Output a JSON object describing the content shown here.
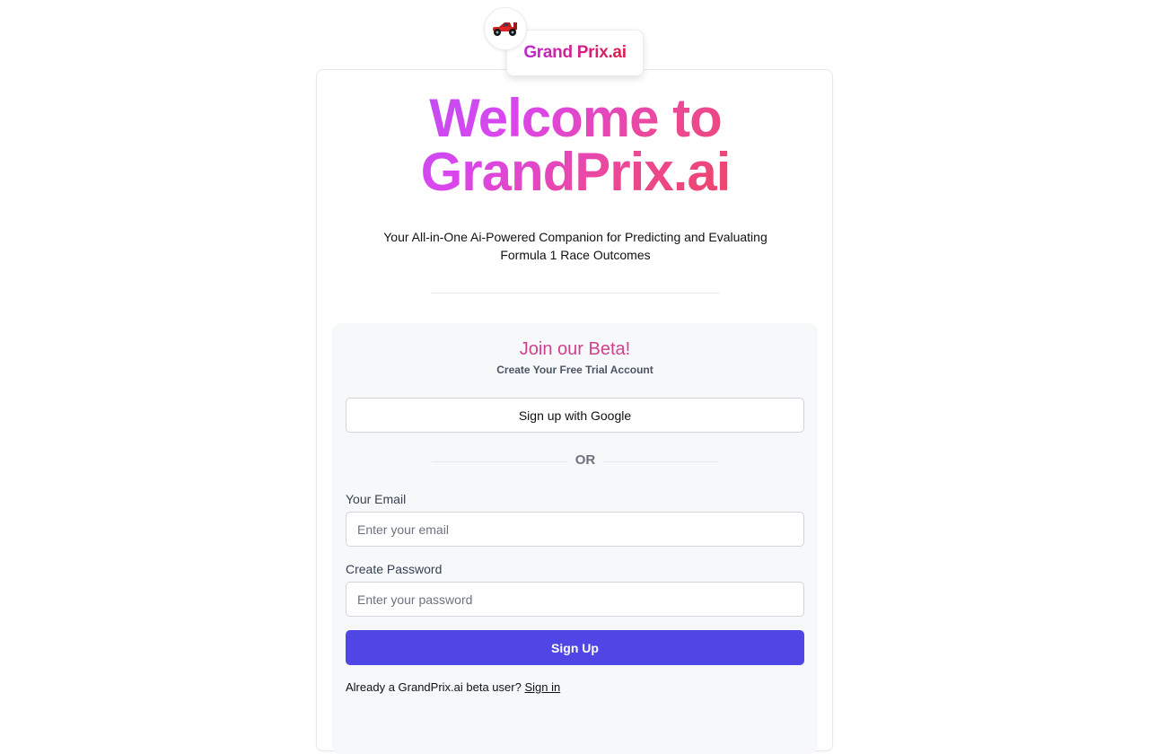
{
  "brand": {
    "logo_icon": "race-car-icon",
    "logo_text": "Grand Prix.ai"
  },
  "hero": {
    "title_line1": "Welcome to",
    "title_line2": "GrandPrix.ai",
    "subtitle_line1": "Your All-in-One Ai-Powered Companion for Predicting and Evaluating",
    "subtitle_line2": "Formula 1 Race Outcomes"
  },
  "signup": {
    "title": "Join our Beta!",
    "subtitle": "Create Your Free Trial Account",
    "google_button": "Sign up with Google",
    "or_text": "OR",
    "email_label": "Your Email",
    "email_placeholder": "Enter your email",
    "email_value": "",
    "password_label": "Create Password",
    "password_placeholder": "Enter your password",
    "password_value": "",
    "submit_button": "Sign Up",
    "already_text": "Already a GrandPrix.ai beta user?",
    "signin_link": "Sign in"
  },
  "colors": {
    "primary_button": "#4f46e5",
    "heading_gradient_start": "#a855f7",
    "heading_gradient_end": "#ef4444",
    "panel_title": "#d0408f"
  }
}
